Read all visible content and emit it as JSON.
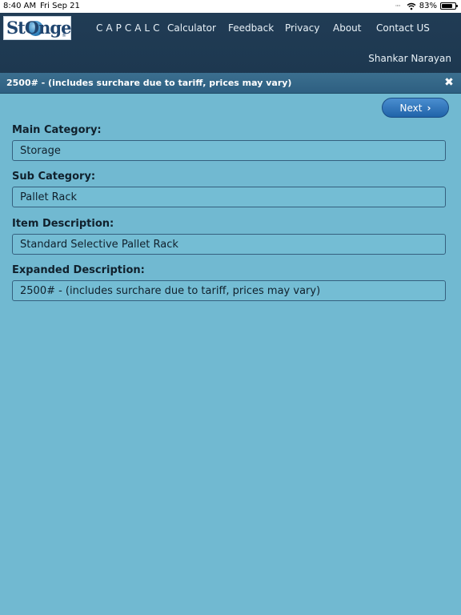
{
  "status_bar": {
    "time": "8:40 AM",
    "date": "Fri Sep 21",
    "battery_percent": "83%",
    "battery_level": 0.83
  },
  "nav": {
    "logo_text": "StOnge",
    "logo_mark": "®",
    "brand": "CAPCALC",
    "links": [
      "Calculator",
      "Feedback",
      "Privacy",
      "About",
      "Contact US"
    ],
    "user_name": "Shankar Narayan"
  },
  "banner": {
    "text": "2500# - (includes surchare due to tariff, prices may vary)",
    "close_icon": "close-icon"
  },
  "actions": {
    "next_label": "Next",
    "next_icon": "chevron-right-icon"
  },
  "form": {
    "fields": [
      {
        "label": "Main Category:",
        "value": "Storage"
      },
      {
        "label": "Sub Category:",
        "value": "Pallet Rack"
      },
      {
        "label": "Item Description:",
        "value": "Standard Selective Pallet Rack"
      },
      {
        "label": "Expanded Description:",
        "value": "2500# - (includes surchare due to tariff, prices may vary)"
      }
    ]
  },
  "colors": {
    "background": "#71b9d1",
    "nav": "#1d3850",
    "banner": "#2e5f81",
    "button": "#2063a9"
  }
}
